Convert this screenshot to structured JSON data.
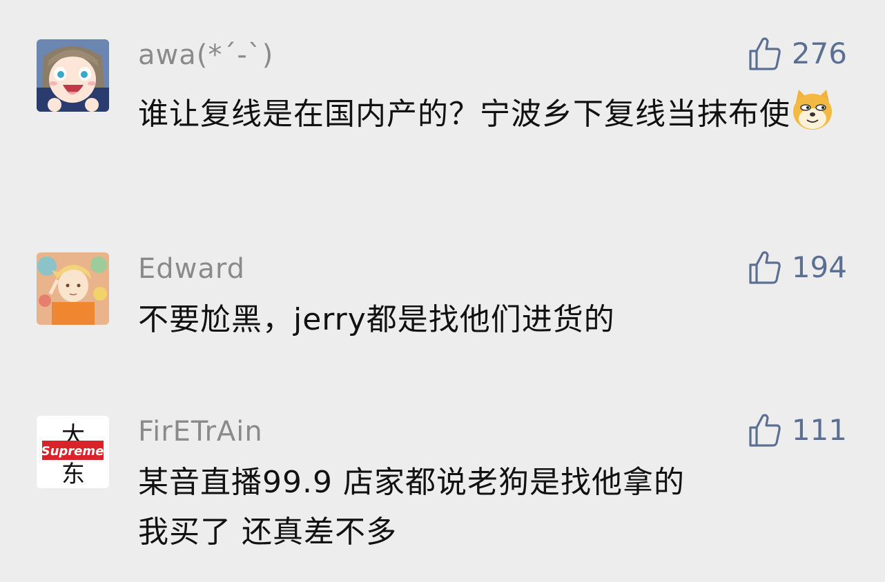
{
  "comments": [
    {
      "username": "awa(*´-`)",
      "likes": "276",
      "text": "谁让复线是在国内产的？宁波乡下复线当抹布使",
      "emoji": "doge-emoji"
    },
    {
      "username": "Edward",
      "likes": "194",
      "text": "不要尬黑，jerry都是找他们进货的"
    },
    {
      "username": "FirETrAin",
      "likes": "111",
      "text_line1": "某音直播99.9 店家都说老狗是找他拿的",
      "text_line2": "我买了 还真差不多",
      "avatar_logo": "Supreme",
      "avatar_chars": "大东"
    }
  ],
  "icons": {
    "like": "thumbs-up-icon"
  },
  "colors": {
    "background": "#ededed",
    "username": "#8a8a8a",
    "like": "#5b6f93",
    "text": "#111111",
    "supreme_red": "#d8232a"
  }
}
